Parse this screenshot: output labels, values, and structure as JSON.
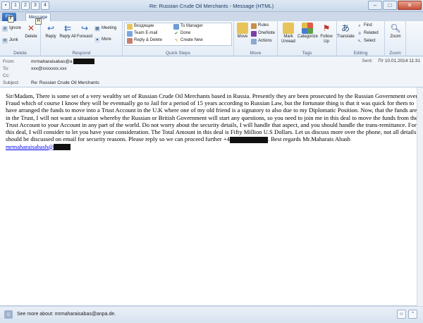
{
  "window": {
    "title": "Re: Russian Crude Oil Merchants - Message (HTML)",
    "qat_keys": [
      "1",
      "2",
      "3",
      "4"
    ],
    "minimize": "–",
    "maximize": "□",
    "close": "✕"
  },
  "tabs": {
    "file": "File",
    "message": "Message",
    "keytip_file": "F",
    "keytip_message": "H"
  },
  "ribbon": {
    "delete_group": {
      "label": "Delete",
      "ignore": "Ignore",
      "junk": "Junk",
      "delete": "Delete"
    },
    "respond_group": {
      "label": "Respond",
      "reply": "Reply",
      "reply_all": "Reply All",
      "forward": "Forward",
      "meeting": "Meeting",
      "more": "More"
    },
    "quick_steps_group": {
      "label": "Quick Steps",
      "items": [
        "Входящие",
        "Team E-mail",
        "Reply & Delete",
        "To Manager",
        "Done",
        "Create New"
      ]
    },
    "move_group": {
      "label": "Move",
      "move": "Move",
      "rules": "Rules",
      "onenote": "OneNote",
      "actions": "Actions"
    },
    "tags_group": {
      "label": "Tags",
      "mark_unread": "Mark Unread",
      "categorize": "Categorize",
      "follow_up": "Follow Up"
    },
    "editing_group": {
      "label": "Editing",
      "translate": "Translate",
      "find": "Find",
      "related": "Related",
      "select": "Select"
    },
    "zoom_group": {
      "label": "Zoom",
      "zoom": "Zoom"
    }
  },
  "header": {
    "from_label": "From:",
    "from_value": "mrmaharaisabas@a",
    "to_label": "To:",
    "to_value": "xxx@xxxxxxx.xxx",
    "cc_label": "Cc:",
    "cc_value": "",
    "subject_label": "Subject:",
    "subject_value": "Re: Russian Crude Oil Merchants",
    "sent_label": "Sent:",
    "sent_value": "Пт 10.01.2014 11:31"
  },
  "message": {
    "text_part1": "Sir/Madam, There is some set of a very wealthy set of Russian Crude Oil Merchants based in Russia. Presently they are been prosecuted by the Russian Government over Fraud which of course I know they will be eventually go to Jail for a period of 15 years according to Russian Law, but the fortunate thing is that it was quick for them to have arranged the funds to move into a Trust Account in the U.K where one of my old friend is a signatory to also due to my Diplomatic Position. Now, that the funds are in the Trust, I will not want a situation whereby the Russian or British Government will start any questions, so you need to join me in this deal to move the funds from the Trust Account to your Account in any part of the world. Do not worry about the security details, I will handle that aspect, and you should handle the trans-remittance. For this deal, I will consider to let you have your consideration. The Total Amount in this deal is Fifty Million U.S Dollars. Let us discuss more over the phone, not all details should be discussed on email for security reasons. Please reply so we can proceed further +4",
    "text_part2": ". Best regards Mr.Maharais Abash",
    "email_link": "mrmaharaisabash@"
  },
  "people_pane": {
    "text": "See more about: mrmaharaisabas@anpa.de."
  }
}
